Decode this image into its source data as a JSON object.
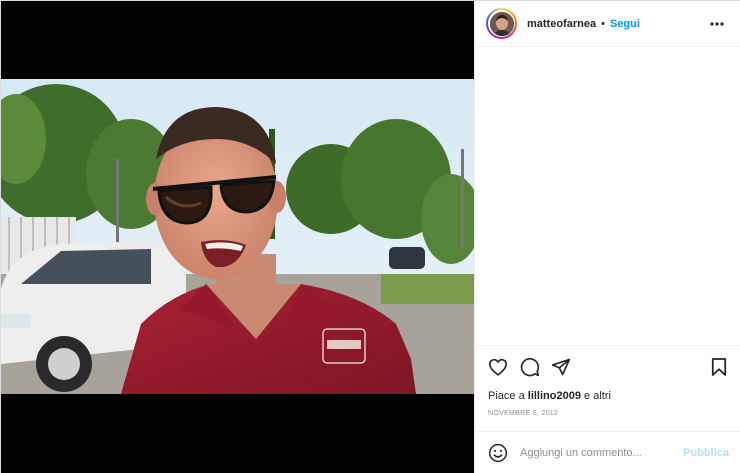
{
  "post": {
    "username": "matteofarnea",
    "separator": "•",
    "follow_label": "Segui"
  },
  "header": {
    "avatar_icon": "profile-avatar",
    "more_icon": "more-horizontal-icon"
  },
  "actions": {
    "like_icon": "heart-icon",
    "comment_icon": "comment-icon",
    "share_icon": "send-icon",
    "save_icon": "bookmark-icon"
  },
  "likes": {
    "prefix": "Piace a",
    "user": "lillino2009",
    "suffix": "e altri"
  },
  "date": "NOVEMBRE 6, 2012",
  "comment_box": {
    "emoji_icon": "emoji-icon",
    "placeholder": "Aggiungi un commento...",
    "publish_label": "Pubblica"
  },
  "colors": {
    "link_blue": "#0095f6",
    "disabled_blue": "#b2dffc",
    "muted_gray": "#8e8e8e",
    "border": "#efefef"
  }
}
